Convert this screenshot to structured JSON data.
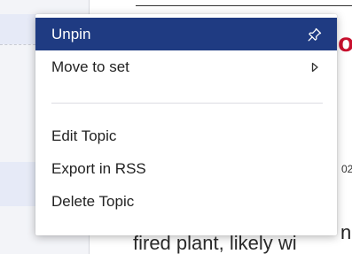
{
  "background": {
    "red_glyph": "o",
    "date_fragment": "02",
    "headline_fragment": "n",
    "body_text_fragment": "fired plant, likely wi"
  },
  "menu": {
    "items": [
      {
        "label": "Unpin",
        "icon": "pin-icon",
        "active": true
      },
      {
        "label": "Move to set",
        "icon": "chevron-right-icon",
        "active": false
      }
    ],
    "items_after_separator": [
      {
        "label": "Edit Topic"
      },
      {
        "label": "Export in RSS"
      },
      {
        "label": "Delete Topic"
      }
    ]
  },
  "colors": {
    "active_bg": "#1f3b82",
    "accent_red": "#c8102e"
  }
}
